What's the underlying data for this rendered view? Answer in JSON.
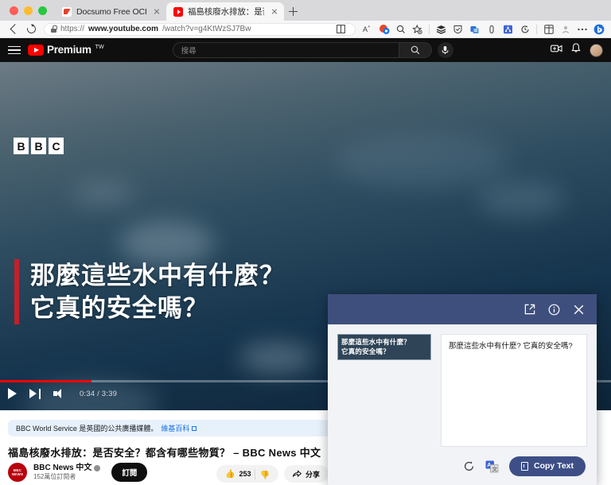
{
  "browser": {
    "traffic_lights": [
      "close",
      "minimize",
      "maximize"
    ],
    "tabs": [
      {
        "title": "Docsumo Free OCR Software",
        "favicon": "docsumo-favicon",
        "active": false
      },
      {
        "title": "福島核廢水排放：是否安全？都",
        "favicon": "youtube-favicon",
        "active": true
      }
    ],
    "new_tab_label": "+",
    "url_scheme": "https://",
    "url_host": "www.youtube.com",
    "url_path": "/watch?v=g4KtWzSJ7Bw",
    "toolbar_icons": [
      "split-screen-icon",
      "read-aloud-icon",
      "copilot-icon",
      "zoom-icon",
      "favorite-icon",
      "collections-icon",
      "shield-icon",
      "browser-essentials-icon",
      "downloads-icon",
      "extensions-icon",
      "history-icon",
      "split-view-icon",
      "profile-icon",
      "more-icon",
      "bing-icon"
    ]
  },
  "youtube": {
    "logo_text": "Premium",
    "logo_superscript": "TW",
    "search_placeholder": "搜尋",
    "header_icons": [
      "create-video-icon",
      "notifications-icon",
      "account-avatar"
    ]
  },
  "player": {
    "brand": "BBC",
    "brand_letters": [
      "B",
      "B",
      "C"
    ],
    "caption_line1": "那麼這些水中有什麼？",
    "caption_line2": "它真的安全嗎？",
    "current_time": "0:34",
    "duration": "3:39",
    "time_display": "0:34 / 3:39",
    "progress_percent": 15,
    "controls": [
      "play-button",
      "next-button",
      "volume-button"
    ],
    "accent_color": "#ff0000",
    "caption_bar_color": "#c4202a"
  },
  "video_info": {
    "wiki_text": "BBC World Service 是英國的公共廣播媒體。",
    "wiki_link": "維基百科",
    "title": "福島核廢水排放：是否安全？都含有哪些物質？ – BBC News 中文",
    "channel_name": "BBC News 中文",
    "channel_avatar_text": "BBC NEWS",
    "subscribers": "152萬位訂閱者",
    "subscribe_label": "訂閱",
    "like_count": "253",
    "share_label": "分享"
  },
  "ocr_popup": {
    "header_icons": [
      "open-external-icon",
      "info-icon",
      "close-icon"
    ],
    "thumbnail_caption_line1": "那麼這些水中有什麼？",
    "thumbnail_caption_line2": "它真的安全嗎？",
    "recognized_text": "那麼這些水中有什麼? 它真的安全嗎?",
    "footer_icons": [
      "refresh-icon",
      "translate-icon"
    ],
    "copy_button_label": "Copy Text",
    "header_color": "#3f4f7d",
    "button_color": "#3d4f86"
  }
}
